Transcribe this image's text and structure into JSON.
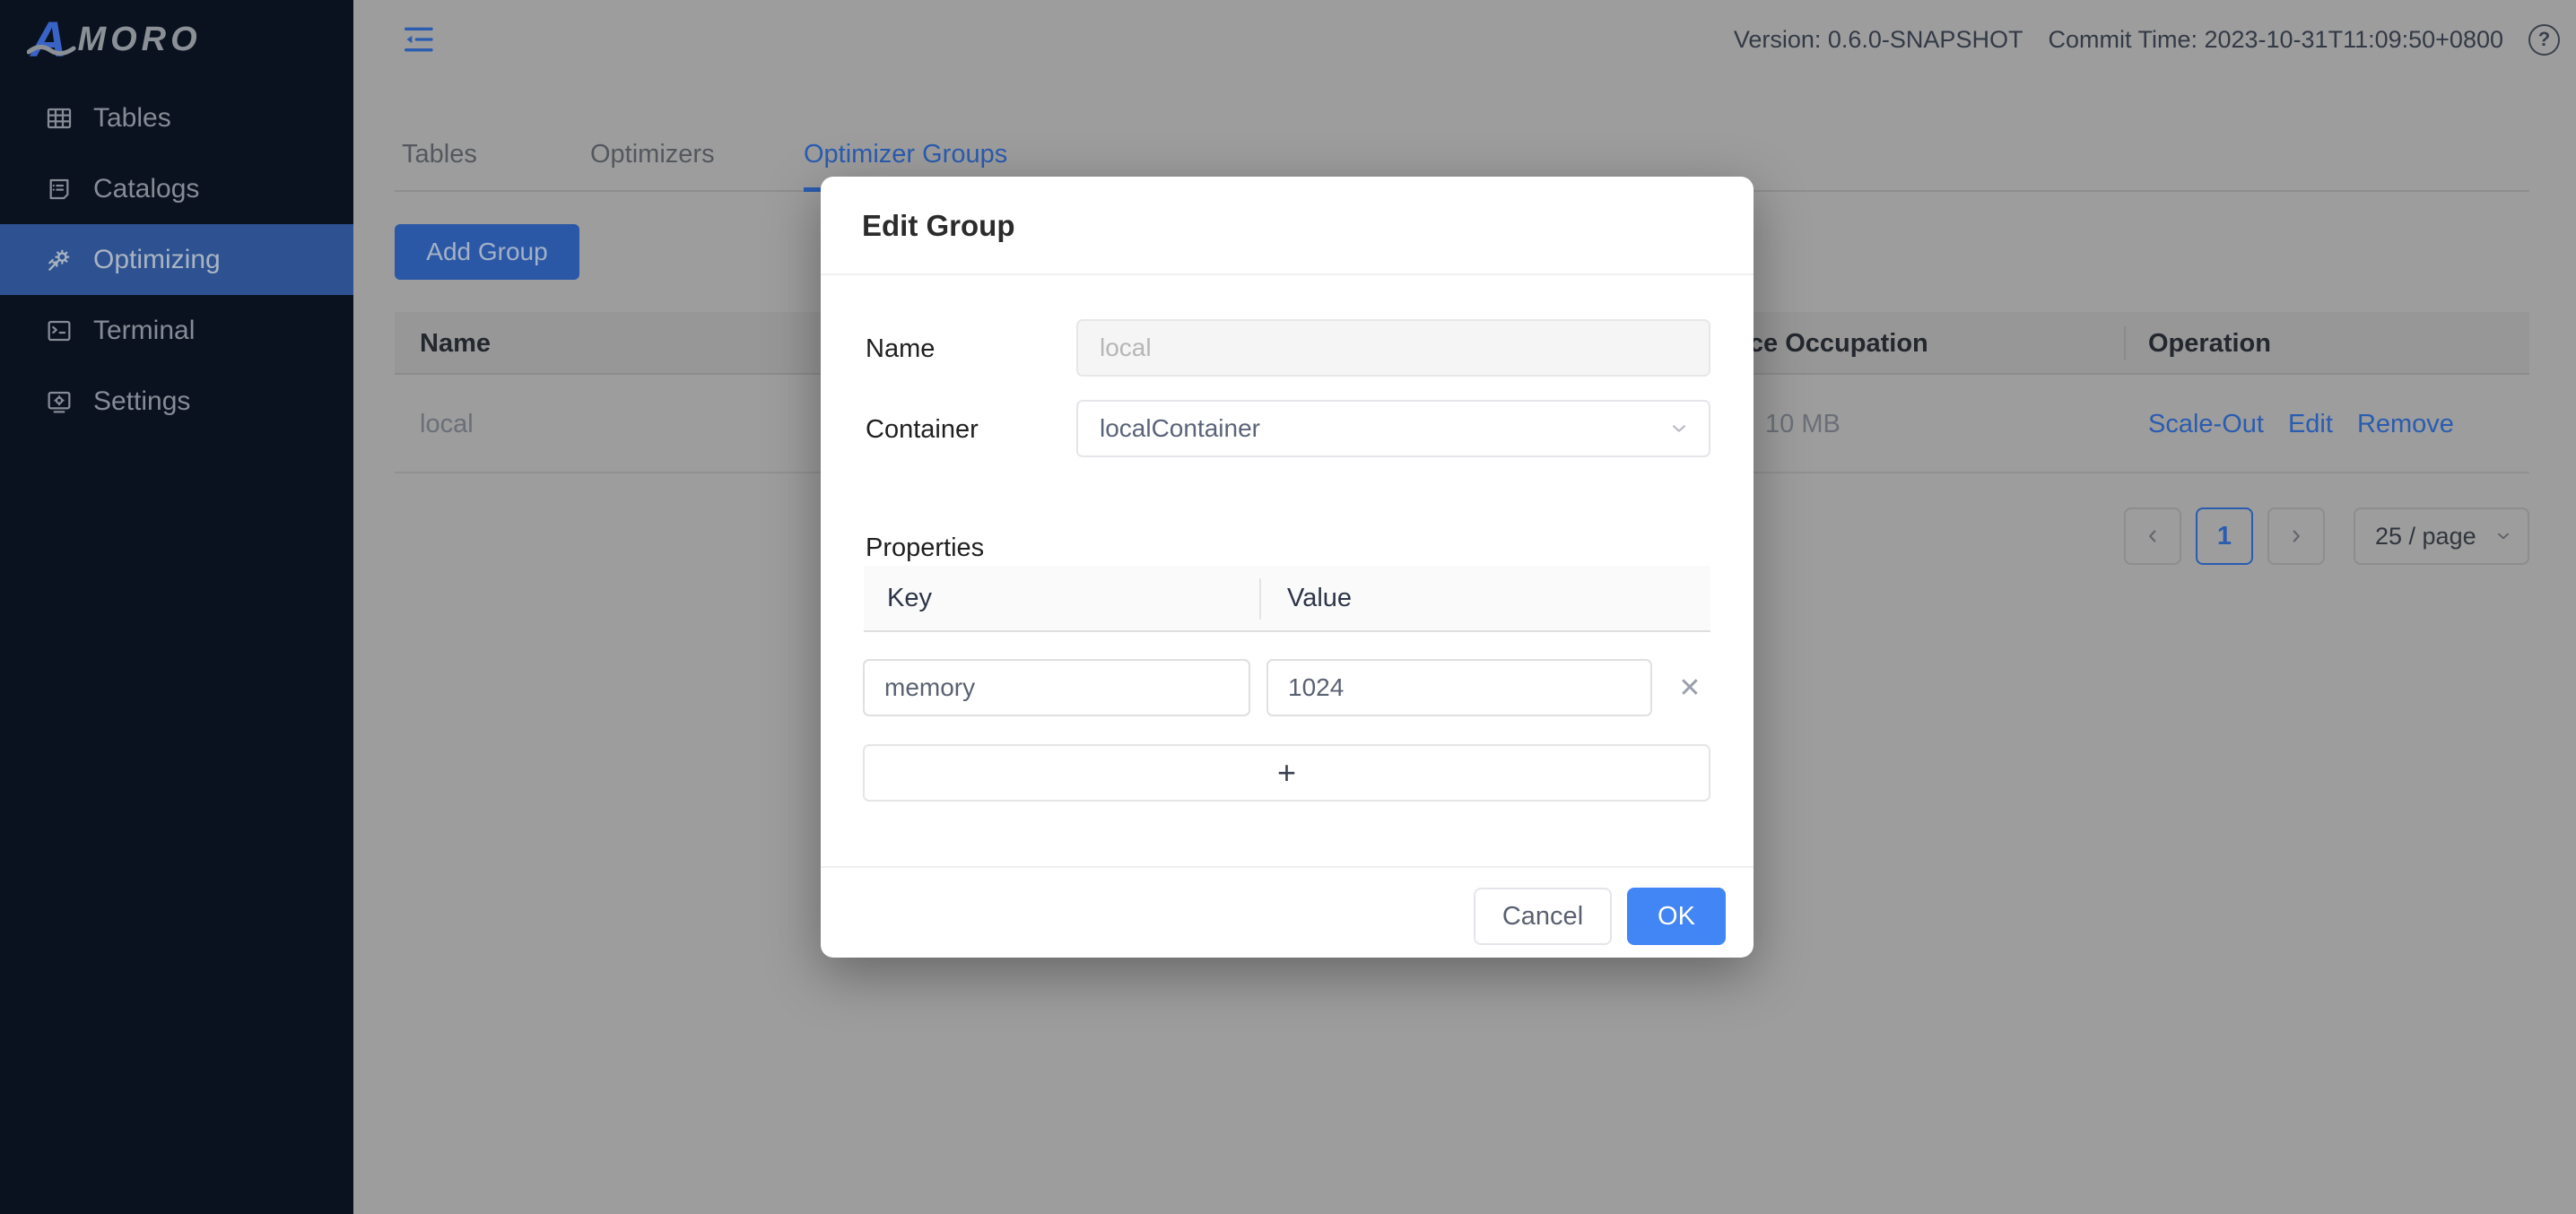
{
  "brand": {
    "logo_letter": "A",
    "logo_text": "MORO"
  },
  "topbar": {
    "version": "Version: 0.6.0-SNAPSHOT",
    "commit_time": "Commit Time: 2023-10-31T11:09:50+0800",
    "help_glyph": "?"
  },
  "sidebar": {
    "items": [
      {
        "label": "Tables",
        "icon": "table-grid-icon",
        "active": false
      },
      {
        "label": "Catalogs",
        "icon": "catalog-document-icon",
        "active": false
      },
      {
        "label": "Optimizing",
        "icon": "optimize-gear-arrows-icon",
        "active": true
      },
      {
        "label": "Terminal",
        "icon": "terminal-icon",
        "active": false
      },
      {
        "label": "Settings",
        "icon": "settings-monitor-icon",
        "active": false
      }
    ]
  },
  "tabs": [
    {
      "label": "Tables",
      "active": false
    },
    {
      "label": "Optimizers",
      "active": false
    },
    {
      "label": "Optimizer Groups",
      "active": true
    }
  ],
  "toolbar": {
    "add_group_label": "Add Group"
  },
  "group_table": {
    "headers": {
      "name": "Name",
      "resource_occupation": "Resource Occupation",
      "operation": "Operation"
    },
    "rows": [
      {
        "name": "local",
        "resource_occupation": "10 MB",
        "op_scale_out": "Scale-Out",
        "op_edit": "Edit",
        "op_remove": "Remove"
      }
    ]
  },
  "pagination": {
    "prev_icon": "chevron-left-icon",
    "current_page": "1",
    "next_icon": "chevron-right-icon",
    "page_size": "25 / page"
  },
  "modal": {
    "title": "Edit Group",
    "name_label": "Name",
    "name_value": "local",
    "container_label": "Container",
    "container_value": "localContainer",
    "properties_label": "Properties",
    "prop_key_header": "Key",
    "prop_value_header": "Value",
    "prop_rows": [
      {
        "key": "memory",
        "value": "1024"
      }
    ],
    "remove_row_glyph": "✕",
    "add_row_label": "+",
    "cancel_label": "Cancel",
    "ok_label": "OK"
  },
  "colors": {
    "accent_blue": "#4285f4",
    "dimmed_accent_blue": "#2a5cb0",
    "sidebar_bg": "#0a1220",
    "sidebar_selected_bg": "#2e5291",
    "mask_page_gray": "#9d9d9d"
  }
}
